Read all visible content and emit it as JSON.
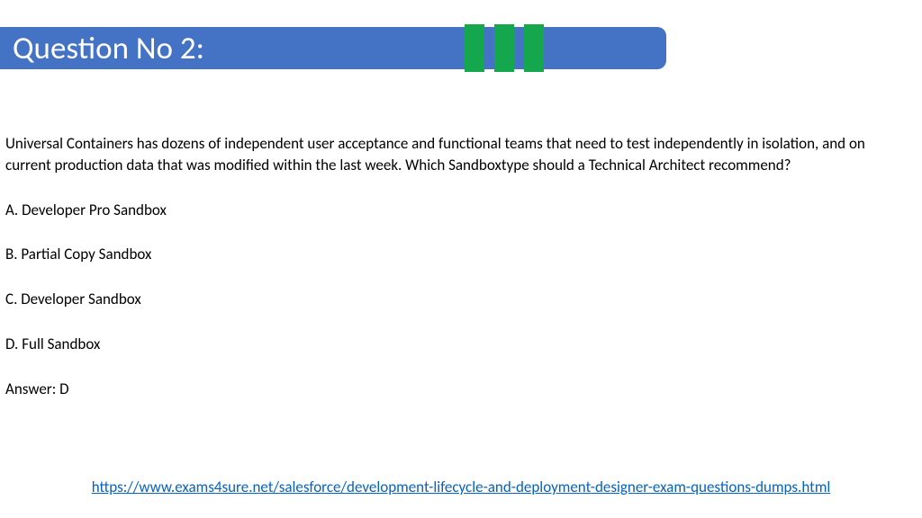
{
  "title": "Question No 2:",
  "question": "Universal Containers has dozens of independent user acceptance and functional teams that need to test independently in isolation, and on current production data that was modified within the last week. Which Sandboxtype should a Technical Architect recommend?",
  "options": {
    "a": "A. Developer Pro Sandbox",
    "b": "B. Partial Copy Sandbox",
    "c": "C. Developer Sandbox",
    "d": "D. Full Sandbox"
  },
  "answer": "Answer: D",
  "link": "https://www.exams4sure.net/salesforce/development-lifecycle-and-deployment-designer-exam-questions-dumps.html"
}
